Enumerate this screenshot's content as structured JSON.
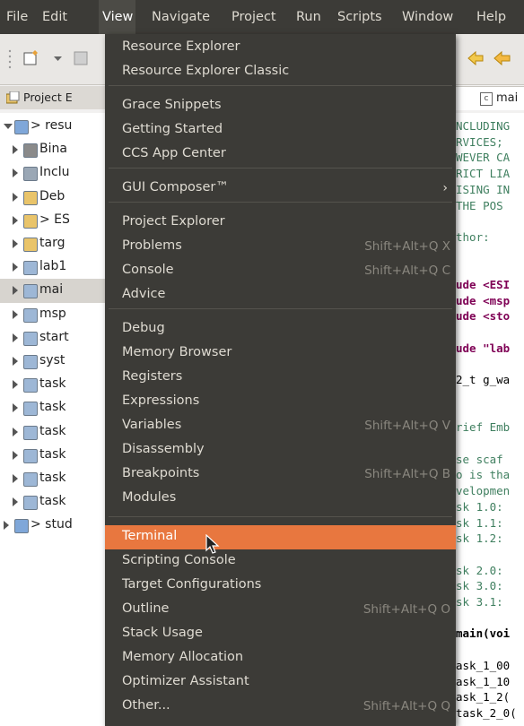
{
  "menubar": {
    "items": [
      {
        "label": "File"
      },
      {
        "label": "Edit"
      },
      {
        "label": "View"
      },
      {
        "label": "Navigate"
      },
      {
        "label": "Project"
      },
      {
        "label": "Run"
      },
      {
        "label": "Scripts"
      },
      {
        "label": "Window"
      },
      {
        "label": "Help"
      }
    ],
    "active": "View"
  },
  "view_menu": {
    "items": [
      {
        "label": "Resource Explorer",
        "shortcut": ""
      },
      {
        "label": "Resource Explorer Classic",
        "shortcut": ""
      },
      {
        "label": "Grace Snippets",
        "shortcut": ""
      },
      {
        "label": "Getting Started",
        "shortcut": ""
      },
      {
        "label": "CCS App Center",
        "shortcut": ""
      },
      {
        "label": "GUI Composer™",
        "shortcut": "",
        "submenu_icon": "chevron-right-icon"
      },
      {
        "label": "Project Explorer",
        "shortcut": ""
      },
      {
        "label": "Problems",
        "shortcut": "Shift+Alt+Q X"
      },
      {
        "label": "Console",
        "shortcut": "Shift+Alt+Q C"
      },
      {
        "label": "Advice",
        "shortcut": ""
      },
      {
        "label": "Debug",
        "shortcut": ""
      },
      {
        "label": "Memory Browser",
        "shortcut": ""
      },
      {
        "label": "Registers",
        "shortcut": ""
      },
      {
        "label": "Expressions",
        "shortcut": ""
      },
      {
        "label": "Variables",
        "shortcut": "Shift+Alt+Q V"
      },
      {
        "label": "Disassembly",
        "shortcut": ""
      },
      {
        "label": "Breakpoints",
        "shortcut": "Shift+Alt+Q B"
      },
      {
        "label": "Modules",
        "shortcut": ""
      },
      {
        "label": "Terminal",
        "shortcut": "",
        "highlighted": true
      },
      {
        "label": "Scripting Console",
        "shortcut": ""
      },
      {
        "label": "Target Configurations",
        "shortcut": ""
      },
      {
        "label": "Outline",
        "shortcut": "Shift+Alt+Q O"
      },
      {
        "label": "Stack Usage",
        "shortcut": ""
      },
      {
        "label": "Memory Allocation",
        "shortcut": ""
      },
      {
        "label": "Optimizer Assistant",
        "shortcut": ""
      },
      {
        "label": "Other...",
        "shortcut": "Shift+Alt+Q Q"
      }
    ],
    "highlight_color": "#e8773f"
  },
  "project_explorer": {
    "tab_label": "Project E",
    "rows": [
      {
        "label": "> resu",
        "icon": "ccs-project-icon",
        "expanded": true
      },
      {
        "label": "Bina",
        "icon": "binaries-icon"
      },
      {
        "label": "Inclu",
        "icon": "includes-icon"
      },
      {
        "label": "Deb",
        "icon": "folder-icon"
      },
      {
        "label": "> ES",
        "icon": "folder-icon"
      },
      {
        "label": "targ",
        "icon": "folder-icon"
      },
      {
        "label": "lab1",
        "icon": "c-file-icon"
      },
      {
        "label": "mai",
        "icon": "c-file-icon",
        "selected": true
      },
      {
        "label": "msp",
        "icon": "c-file-icon"
      },
      {
        "label": "start",
        "icon": "c-file-icon"
      },
      {
        "label": "syst",
        "icon": "c-file-icon"
      },
      {
        "label": "task",
        "icon": "c-file-icon"
      },
      {
        "label": "task",
        "icon": "c-file-icon"
      },
      {
        "label": "task",
        "icon": "c-file-icon"
      },
      {
        "label": "task",
        "icon": "c-file-icon"
      },
      {
        "label": "task",
        "icon": "c-file-icon"
      },
      {
        "label": "task",
        "icon": "c-file-icon"
      },
      {
        "label": "> stud",
        "icon": "ccs-project-icon"
      }
    ]
  },
  "editor": {
    "tab_label": "mai",
    "lines": [
      {
        "text": "NCLUDING",
        "style": "comment"
      },
      {
        "text": "RVICES;",
        "style": "comment"
      },
      {
        "text": "WEVER CA",
        "style": "comment"
      },
      {
        "text": "RICT LIA",
        "style": "comment"
      },
      {
        "text": "ISING IN",
        "style": "comment"
      },
      {
        "text": "THE POS",
        "style": "comment"
      },
      {
        "text": "",
        "style": "comment"
      },
      {
        "text": "thor:",
        "style": "comment"
      },
      {
        "text": "",
        "style": "plain"
      },
      {
        "text": "",
        "style": "plain"
      },
      {
        "text": "ude <ESI",
        "style": "kw"
      },
      {
        "text": "ude <msp",
        "style": "kw"
      },
      {
        "text": "ude <sto",
        "style": "kw"
      },
      {
        "text": "",
        "style": "plain"
      },
      {
        "text": "ude \"lab",
        "style": "kw"
      },
      {
        "text": "",
        "style": "plain"
      },
      {
        "text": "2_t g_wa",
        "style": "plain"
      },
      {
        "text": "",
        "style": "plain"
      },
      {
        "text": "",
        "style": "plain"
      },
      {
        "text": "rief Emb",
        "style": "comment"
      },
      {
        "text": "",
        "style": "plain"
      },
      {
        "text": "se scaf",
        "style": "comment"
      },
      {
        "text": "o is tha",
        "style": "comment"
      },
      {
        "text": "velopmen",
        "style": "comment"
      },
      {
        "text": "sk 1.0:",
        "style": "comment"
      },
      {
        "text": "sk 1.1:",
        "style": "comment"
      },
      {
        "text": "sk 1.2:",
        "style": "comment"
      },
      {
        "text": "",
        "style": "plain"
      },
      {
        "text": "sk 2.0:",
        "style": "comment"
      },
      {
        "text": "sk 3.0:",
        "style": "comment"
      },
      {
        "text": "sk 3.1:",
        "style": "comment"
      },
      {
        "text": "",
        "style": "plain"
      },
      {
        "text": "main(voi",
        "style": "plainbold"
      },
      {
        "text": "",
        "style": "plain"
      },
      {
        "text": "ask_1_00",
        "style": "plain"
      },
      {
        "text": "ask_1_10",
        "style": "plain"
      },
      {
        "text": "ask_1_2(",
        "style": "plain"
      },
      {
        "text": "task_2_0(",
        "style": "plain"
      }
    ]
  }
}
